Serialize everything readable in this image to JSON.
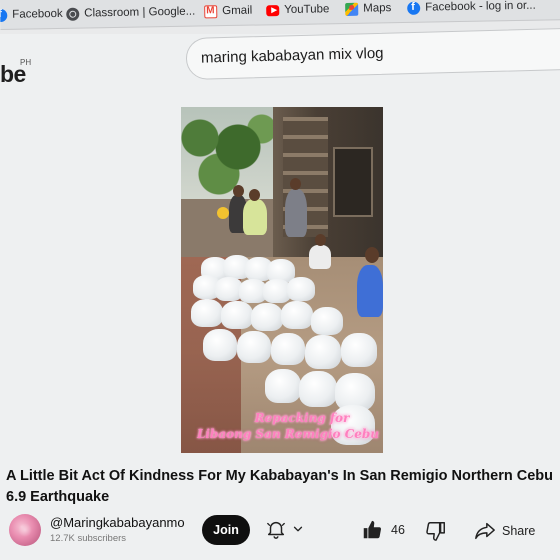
{
  "bookmarks": [
    {
      "label": "Facebook",
      "icon": "facebook-icon"
    },
    {
      "label": "Classroom | Google...",
      "icon": "globe-icon"
    },
    {
      "label": "Gmail",
      "icon": "gmail-icon"
    },
    {
      "label": "YouTube",
      "icon": "youtube-icon"
    },
    {
      "label": "Maps",
      "icon": "maps-icon"
    },
    {
      "label": "Facebook - log in or...",
      "icon": "facebook-icon"
    }
  ],
  "header": {
    "logo_fragment": "be",
    "logo_region": "PH",
    "search_value": "maring kababayan mix vlog"
  },
  "video": {
    "caption_line1": "Repacking for",
    "caption_line2": "Libaong San Remigio Cebu"
  },
  "title": "A Little Bit Act Of Kindness For My Kababayan's In San Remigio Northern Cebu 6.9 Earthquake",
  "channel": {
    "name": "@Maringkababayanmo",
    "subscribers": "12.7K subscribers",
    "join_label": "Join"
  },
  "actions": {
    "like_count": "46",
    "share_label": "Share"
  },
  "colors": {
    "accent_youtube_red": "#ff0000",
    "join_button": "#0f0f0f",
    "caption_pink": "#ff7fbf"
  }
}
